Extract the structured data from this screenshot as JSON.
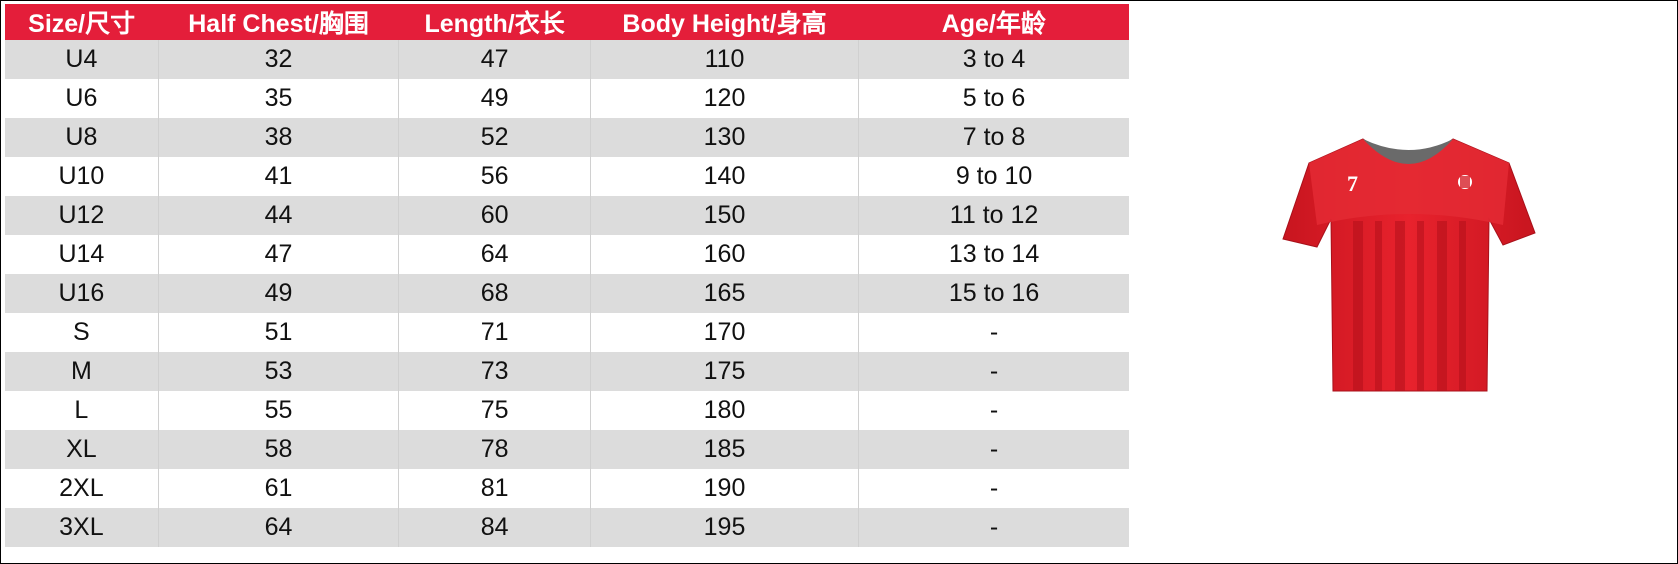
{
  "table": {
    "headers": [
      "Size/尺寸",
      "Half Chest/胸围",
      "Length/衣长",
      "Body Height/身高",
      "Age/年龄"
    ],
    "rows": [
      [
        "U4",
        "32",
        "47",
        "110",
        "3 to 4"
      ],
      [
        "U6",
        "35",
        "49",
        "120",
        "5 to 6"
      ],
      [
        "U8",
        "38",
        "52",
        "130",
        "7 to 8"
      ],
      [
        "U10",
        "41",
        "56",
        "140",
        "9 to 10"
      ],
      [
        "U12",
        "44",
        "60",
        "150",
        "11 to 12"
      ],
      [
        "U14",
        "47",
        "64",
        "160",
        "13 to 14"
      ],
      [
        "U16",
        "49",
        "68",
        "165",
        "15 to 16"
      ],
      [
        "S",
        "51",
        "71",
        "170",
        "-"
      ],
      [
        "M",
        "53",
        "73",
        "175",
        "-"
      ],
      [
        "L",
        "55",
        "75",
        "180",
        "-"
      ],
      [
        "XL",
        "58",
        "78",
        "185",
        "-"
      ],
      [
        "2XL",
        "61",
        "81",
        "190",
        "-"
      ],
      [
        "3XL",
        "64",
        "84",
        "195",
        "-"
      ]
    ]
  },
  "jersey": {
    "number": "7",
    "body_color": "#e0202d",
    "stripe_color": "#c0141f",
    "collar_color": "#6a6a6a"
  },
  "colors": {
    "header_bg": "#e41e3a",
    "header_text": "#ffffff",
    "row_alt_bg": "#dcdcdc"
  }
}
